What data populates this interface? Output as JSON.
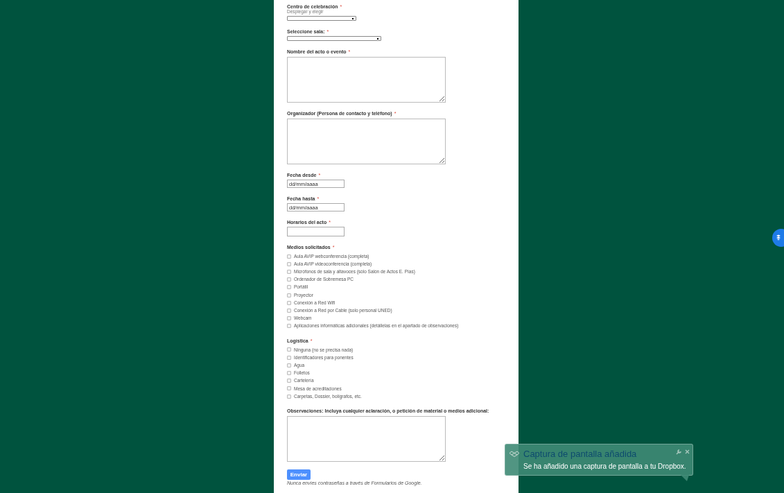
{
  "form": {
    "fields": [
      {
        "kind": "select",
        "label": "Centro de celebración",
        "required_mark": "*",
        "hint": "Desplegar y elegir"
      },
      {
        "kind": "select",
        "label": "Seleccione sala:",
        "required_mark": "*"
      },
      {
        "kind": "textarea",
        "label": "Nombre del acto o evento",
        "required_mark": "*"
      },
      {
        "kind": "textarea",
        "label": "Organizador (Persona de contacto y teléfono)",
        "required_mark": "*"
      },
      {
        "kind": "text",
        "label": "Fecha desde",
        "required_mark": "*",
        "value": "dd/mm/aaaa"
      },
      {
        "kind": "text",
        "label": "Fecha hasta",
        "required_mark": "*",
        "value": "dd/mm/aaaa"
      },
      {
        "kind": "text",
        "label": "Horarios del acto",
        "required_mark": "*"
      },
      {
        "kind": "checkboxes",
        "label": "Medios solicitados",
        "required_mark": "*",
        "options": [
          {
            "label": "Aula AVIP webconferencia (completa)",
            "checked": false
          },
          {
            "label": "Aula AVIP videoconferencia (completa)",
            "checked": false
          },
          {
            "label": "Micrófonos de sala y altavoces (sólo Salón de Actos E. Pías)",
            "checked": false
          },
          {
            "label": "Ordenador de Sobremesa PC",
            "checked": false
          },
          {
            "label": "Portátil",
            "checked": false
          },
          {
            "label": "Proyector",
            "checked": false
          },
          {
            "label": "Conexión a Red Wifi",
            "checked": false
          },
          {
            "label": "Conexión a Red por Cable (solo personal UNED)",
            "checked": false
          },
          {
            "label": "Webcam",
            "checked": false
          },
          {
            "label": "Aplicaciones informáticas adicionales (detállelas en el apartado de observaciones)",
            "checked": false
          }
        ]
      },
      {
        "kind": "checkboxes",
        "label": "Logística",
        "required_mark": "*",
        "options": [
          {
            "label": "Ninguna (no se precisa nada)",
            "checked": false
          },
          {
            "label": "Identificadores para ponentes",
            "checked": false
          },
          {
            "label": "Agua",
            "checked": false
          },
          {
            "label": "Folletos",
            "checked": false
          },
          {
            "label": "Cartelería",
            "checked": false
          },
          {
            "label": "Mesa de acreditaciones",
            "checked": false
          },
          {
            "label": "Carpetas, Dossier, bolígrafos, etc.",
            "checked": false
          }
        ]
      },
      {
        "kind": "textarea",
        "label": "Observaciones: Incluya cualquier aclaración, o petición de material o medios adicional:"
      }
    ],
    "submit": "Enviar",
    "footer": "Nunca envíes contraseñas a través de Formularios de Google."
  },
  "notification": {
    "title": "Captura de pantalla añadida",
    "message": "Se ha añadido una captura de pantalla a tu Dropbox."
  }
}
